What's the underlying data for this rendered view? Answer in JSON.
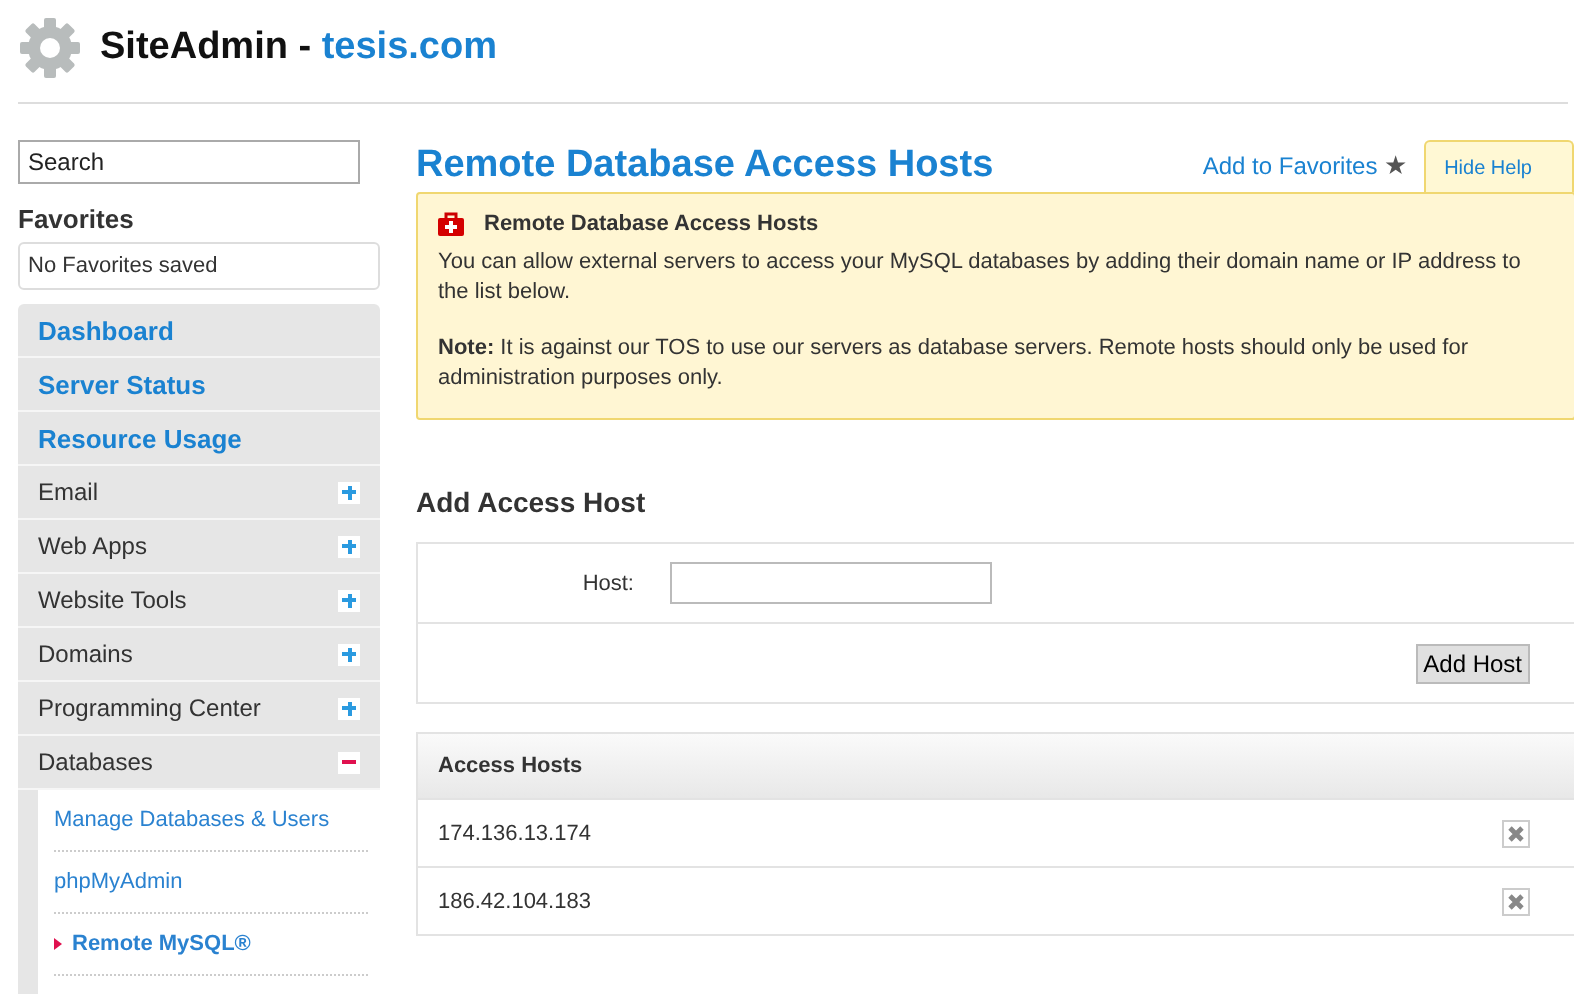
{
  "header": {
    "title": "SiteAdmin",
    "separator": "-",
    "domain": "tesis.com"
  },
  "sidebar": {
    "search": {
      "placeholder": "Search"
    },
    "favorites": {
      "heading": "Favorites",
      "empty": "No Favorites saved"
    },
    "items": [
      {
        "kind": "link",
        "label": "Dashboard"
      },
      {
        "kind": "link",
        "label": "Server Status"
      },
      {
        "kind": "link",
        "label": "Resource Usage"
      },
      {
        "kind": "group",
        "label": "Email",
        "expanded": false
      },
      {
        "kind": "group",
        "label": "Web Apps",
        "expanded": false
      },
      {
        "kind": "group",
        "label": "Website Tools",
        "expanded": false
      },
      {
        "kind": "group",
        "label": "Domains",
        "expanded": false
      },
      {
        "kind": "group",
        "label": "Programming Center",
        "expanded": false
      },
      {
        "kind": "group",
        "label": "Databases",
        "expanded": true,
        "children": [
          {
            "label": "Manage Databases & Users",
            "selected": false
          },
          {
            "label": "phpMyAdmin",
            "selected": false
          },
          {
            "label": "Remote MySQL®",
            "selected": true
          }
        ]
      }
    ]
  },
  "page": {
    "title": "Remote Database Access Hosts",
    "add_favorites": "Add to Favorites",
    "star": "★",
    "help_tab": "Hide Help",
    "help": {
      "title": "Remote Database Access Hosts",
      "text": "You can allow external servers to access your MySQL databases by adding their domain name or IP address to the list below.",
      "note": "**Note:** It is against our TOS to use our servers as database servers. Remote hosts should only be used for administration purposes only."
    },
    "form": {
      "heading": "Add Access Host",
      "host_label": "Host:",
      "button": "Add Host"
    },
    "table": {
      "heading": "Access Hosts",
      "rows": [
        "174.136.13.174",
        "186.42.104.183"
      ]
    }
  }
}
